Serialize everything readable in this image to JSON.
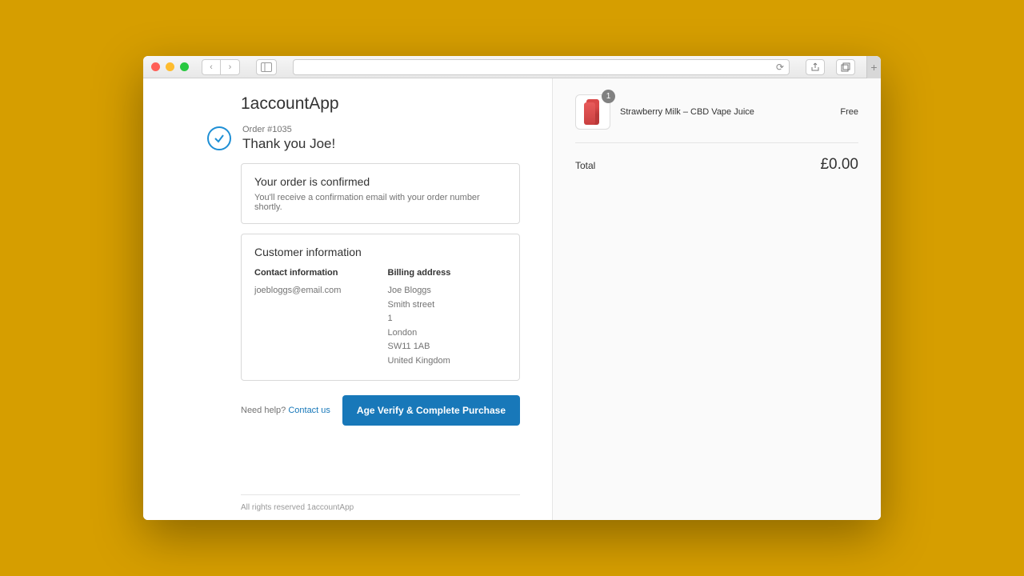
{
  "brand": "1accountApp",
  "order": {
    "number_label": "Order #1035",
    "thank_you": "Thank you Joe!"
  },
  "confirm_card": {
    "title": "Your order is confirmed",
    "sub": "You'll receive a confirmation email with your order number shortly."
  },
  "info_card": {
    "title": "Customer information",
    "contact": {
      "heading": "Contact information",
      "email": "joebloggs@email.com"
    },
    "billing": {
      "heading": "Billing address",
      "name": "Joe Bloggs",
      "street": "Smith street",
      "num": "1",
      "city": "London",
      "postcode": "SW11 1AB",
      "country": "United Kingdom"
    }
  },
  "help": {
    "prefix": "Need help? ",
    "link": "Contact us"
  },
  "cta_label": "Age Verify & Complete Purchase",
  "footer": "All rights reserved 1accountApp",
  "summary": {
    "item": {
      "qty": "1",
      "name": "Strawberry Milk – CBD Vape Juice",
      "price": "Free"
    },
    "total_label": "Total",
    "total_amount": "£0.00"
  }
}
